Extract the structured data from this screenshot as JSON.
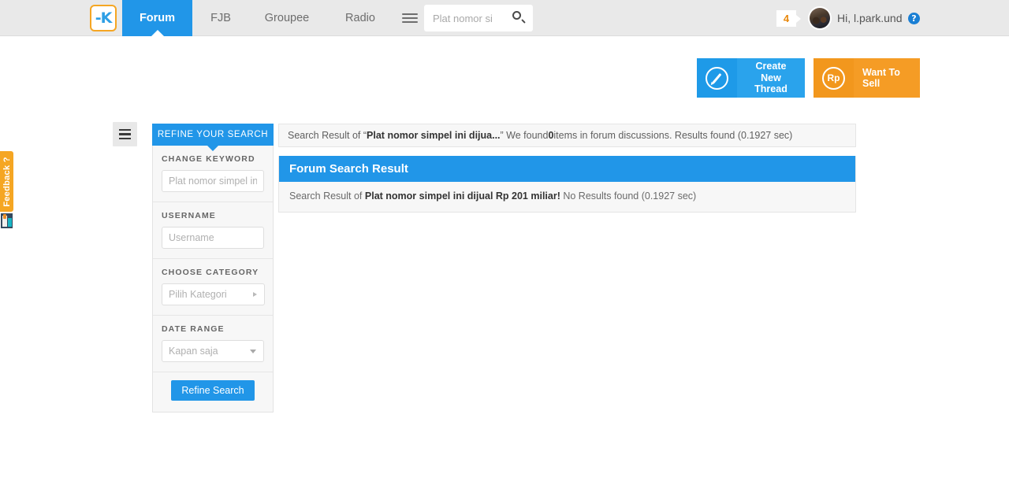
{
  "header": {
    "logo_alt": "kaskus-logo",
    "nav": [
      {
        "label": "Forum",
        "active": true
      },
      {
        "label": "FJB",
        "active": false
      },
      {
        "label": "Groupee",
        "active": false
      },
      {
        "label": "Radio",
        "active": false
      }
    ],
    "menu_icon": "hamburger-icon",
    "search": {
      "value": "Plat nomor si",
      "placeholder": "Plat nomor si",
      "icon": "search-icon"
    },
    "notification_count": "4",
    "greeting": "Hi, l.park.und",
    "help_icon": "question-mark-icon"
  },
  "actions": {
    "create_thread": {
      "label": "Create New Thread",
      "icon": "pencil-circle-icon",
      "color": "#2aa3ec"
    },
    "want_to_sell": {
      "label": "Want To Sell",
      "icon": "rupiah-circle-icon",
      "icon_text": "Rp",
      "color": "#f59c25"
    }
  },
  "feedback_tab": {
    "label": "Feedback ?",
    "color": "#f5a623"
  },
  "sidebar": {
    "toggle_icon": "hamburger-icon",
    "header": "REFINE YOUR SEARCH",
    "groups": [
      {
        "label": "CHANGE KEYWORD",
        "type": "text",
        "value": "Plat nomor simpel in",
        "placeholder": "Plat nomor simpel in"
      },
      {
        "label": "USERNAME",
        "type": "text",
        "value": "",
        "placeholder": "Username"
      },
      {
        "label": "CHOOSE CATEGORY",
        "type": "select-right",
        "value": "Pilih Kategori"
      },
      {
        "label": "DATE RANGE",
        "type": "select-down",
        "value": "Kapan saja"
      }
    ],
    "submit_label": "Refine Search"
  },
  "results": {
    "summary": {
      "prefix": "Search Result of “",
      "query": "Plat nomor simpel ini dijua...",
      "middle": "” We found ",
      "count": "0",
      "suffix": " items in forum discussions. Results found (0.1927 sec)"
    },
    "panel_title": "Forum Search Result",
    "detail": {
      "prefix": "Search Result of ",
      "query": "Plat nomor simpel ini dijual Rp 201 miliar!",
      "suffix": " No Results found (0.1927 sec)"
    }
  }
}
